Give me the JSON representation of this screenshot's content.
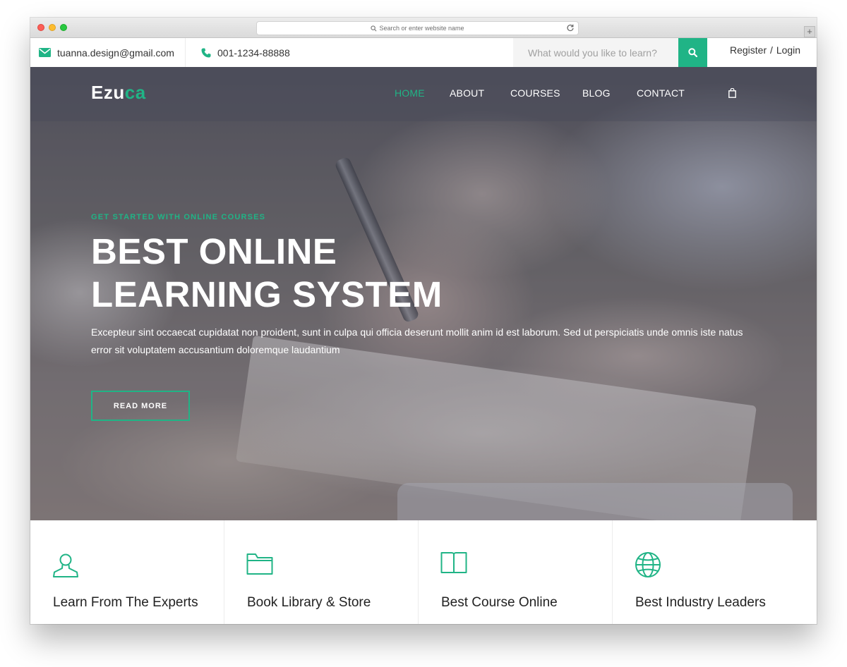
{
  "browser": {
    "address_placeholder": "Search or enter website name",
    "new_tab_symbol": "+"
  },
  "topbar": {
    "email": "tuanna.design@gmail.com",
    "phone": "001-1234-88888",
    "search_placeholder": "What would you like to learn?",
    "register_label": "Register",
    "auth_separator": "/",
    "login_label": "Login"
  },
  "nav": {
    "logo_main": "Ezu",
    "logo_accent": "ca",
    "items": [
      {
        "label": "HOME",
        "active": true
      },
      {
        "label": "ABOUT",
        "active": false
      },
      {
        "label": "COURSES",
        "active": false
      },
      {
        "label": "BLOG",
        "active": false
      },
      {
        "label": "CONTACT",
        "active": false
      }
    ]
  },
  "hero": {
    "kicker": "GET STARTED WITH ONLINE COURSES",
    "headline_line1": "BEST ONLINE",
    "headline_line2": "LEARNING SYSTEM",
    "lead": "Excepteur sint occaecat cupidatat non proident, sunt in culpa qui officia deserunt mollit anim id est laborum. Sed ut perspiciatis unde omnis iste natus error sit voluptatem accusantium doloremque laudantium",
    "cta_label": "READ MORE"
  },
  "features": [
    {
      "title": "Learn From The Experts",
      "icon": "user-icon"
    },
    {
      "title": "Book Library & Store",
      "icon": "folder-icon"
    },
    {
      "title": "Best Course Online",
      "icon": "book-icon"
    },
    {
      "title": "Best Industry Leaders",
      "icon": "globe-icon"
    }
  ],
  "colors": {
    "accent": "#20b486",
    "text_dark": "#222222",
    "topbar_search_bg": "#f4f4f4"
  }
}
